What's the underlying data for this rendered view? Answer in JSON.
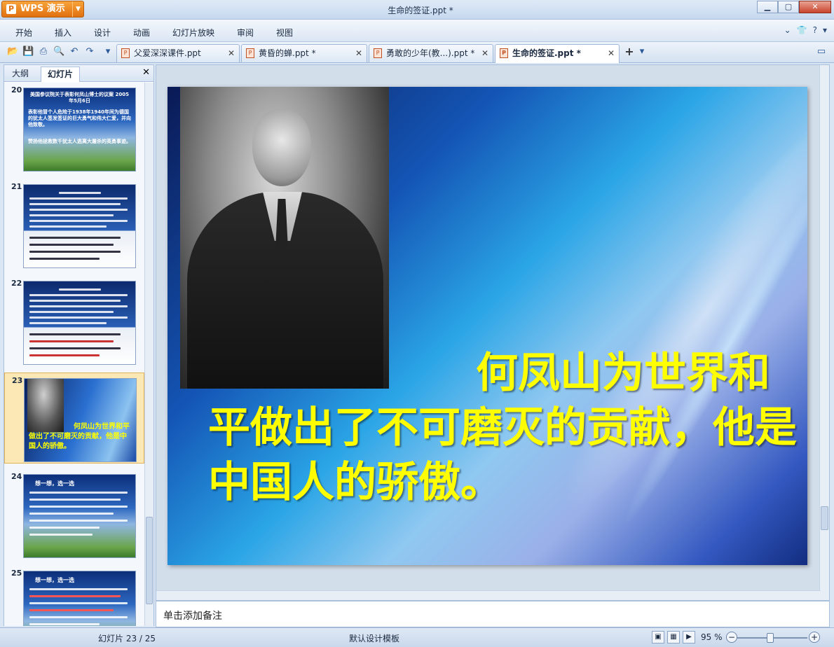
{
  "app": {
    "name": "WPS 演示",
    "window_title": "生命的签证.ppt *"
  },
  "menu": [
    "开始",
    "插入",
    "设计",
    "动画",
    "幻灯片放映",
    "审阅",
    "视图"
  ],
  "doc_tabs": [
    {
      "label": "父爱深深课件.ppt",
      "active": false
    },
    {
      "label": "黄昏的蝉.ppt *",
      "active": false
    },
    {
      "label": "勇敢的少年(教...).ppt *",
      "active": false
    },
    {
      "label": "生命的签证.ppt *",
      "active": true
    }
  ],
  "panel": {
    "tabs": [
      "大纲",
      "幻灯片"
    ],
    "active_tab": "幻灯片",
    "thumbnails": [
      {
        "number": "20",
        "title": "美国参议院关于表彰何凤山博士的议案 2005年5月6日",
        "lines": [
          "表彰他冒个人危险于1938年1940年间为德国的犹太人签发签证的巨大勇气和伟大仁爱，并向他致敬。",
          "赞扬他拯救数千犹太人逃离大屠杀的英勇事迹。"
        ]
      },
      {
        "number": "21",
        "title": "",
        "lines": []
      },
      {
        "number": "22",
        "title": "",
        "lines": []
      },
      {
        "number": "23",
        "title": "",
        "lines": [
          "何凤山为世界和平做出了不可磨灭的贡献，他是中国人的骄傲。"
        ],
        "selected": true
      },
      {
        "number": "24",
        "title": "想一想，选一选",
        "lines": []
      },
      {
        "number": "25",
        "title": "想一想，选一选",
        "lines": []
      }
    ]
  },
  "slide": {
    "text": "何凤山为世界和平做出了不可磨灭的贡献，他是中国人的骄傲。"
  },
  "notes": {
    "placeholder": "单击添加备注"
  },
  "status": {
    "slide_info": "幻灯片 23 / 25",
    "template": "默认设计模板",
    "zoom": "95 %",
    "zoom_fraction": 0.95
  }
}
